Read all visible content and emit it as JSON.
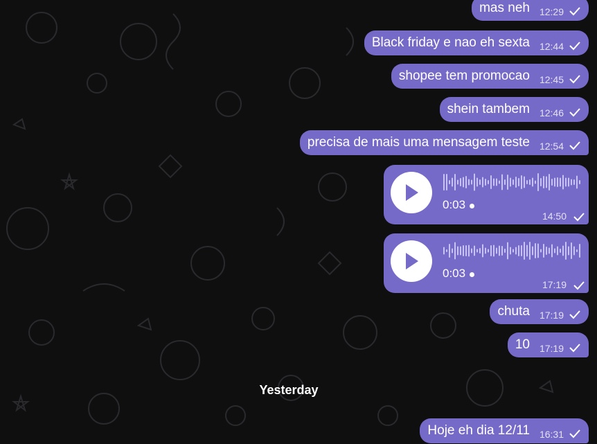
{
  "messages": [
    {
      "text": "mas neh",
      "time": "12:29"
    },
    {
      "text": "Black friday e nao eh sexta",
      "time": "12:44"
    },
    {
      "text": "shopee tem promocao",
      "time": "12:45"
    },
    {
      "text": "shein tambem",
      "time": "12:46"
    },
    {
      "text": "precisa de mais uma mensagem teste",
      "time": "12:54"
    }
  ],
  "voice_messages": [
    {
      "duration": "0:03",
      "time": "14:50"
    },
    {
      "duration": "0:03",
      "time": "17:19"
    }
  ],
  "messages_after": [
    {
      "text": "chuta",
      "time": "17:19"
    },
    {
      "text": "10",
      "time": "17:19"
    }
  ],
  "date_separator": "Yesterday",
  "last_message": {
    "text": "Hoje eh dia 12/11",
    "time": "16:31"
  },
  "colors": {
    "bubble": "#766ac8",
    "background": "#0f0f10"
  },
  "icons": {
    "read": "check-icon",
    "play": "play-icon"
  }
}
